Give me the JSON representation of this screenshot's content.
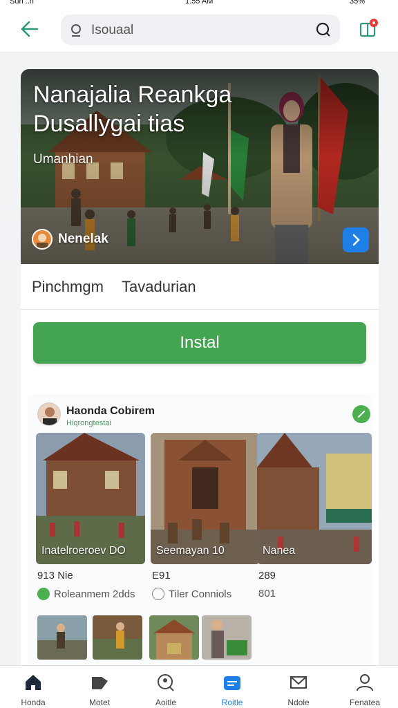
{
  "status": {
    "left": "Sun ..n",
    "time": "1:55 AM",
    "right": "35%"
  },
  "search": {
    "text": "Isouaal"
  },
  "hero": {
    "title": "Nanajalia Reankga Dusallygai tias",
    "subtitle": "Umanhian",
    "author": "Nenelak"
  },
  "tabs": [
    "Pinchmgm",
    "Tavadurian"
  ],
  "install_label": "Instal",
  "gallery": {
    "title": "Haonda Cobirem",
    "subtitle": "Hiqrongtestai",
    "photos": [
      {
        "caption": "Inatelroeroev  DO",
        "stat": "913 Nie",
        "meta": "Roleanmem 2dds",
        "meta_color": "#4caf50"
      },
      {
        "caption": "Seemayan 10",
        "stat": "E91",
        "meta": "Tiler  Conniols",
        "meta_color": "#888888"
      },
      {
        "caption": "Nanea",
        "stat": "289",
        "meta": "801",
        "meta_color": ""
      }
    ]
  },
  "nav": [
    {
      "label": "Honda",
      "icon": "home-icon",
      "active": true
    },
    {
      "label": "Motet",
      "icon": "store-icon",
      "active": false
    },
    {
      "label": "Aoitle",
      "icon": "search-person-icon",
      "active": false
    },
    {
      "label": "Roitle",
      "icon": "apps-icon",
      "active": false
    },
    {
      "label": "Ndole",
      "icon": "inbox-icon",
      "active": false
    },
    {
      "label": "Fenatea",
      "icon": "profile-icon",
      "active": false
    }
  ],
  "colors": {
    "accent": "#43a451",
    "active_nav": "#1e7fe6",
    "back_arrow": "#2b9a7a"
  }
}
